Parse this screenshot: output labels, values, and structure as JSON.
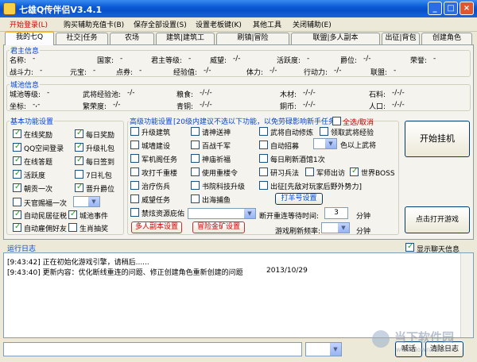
{
  "window": {
    "title": "七雄Q传伴侣V3.4.1",
    "min": "_",
    "max": "□",
    "close": "×"
  },
  "menu": [
    "开始登录(L)",
    "购买辅助充值卡(B)",
    "保存全部设置(S)",
    "设置老板键(K)",
    "其他工具",
    "关闭辅助(E)"
  ],
  "tabs": [
    "我的七Q",
    "社交|任务",
    "农场",
    "建筑|建筑工",
    "刷镇|冒险",
    "联盟|多人副本",
    "出征|背包",
    "创建角色"
  ],
  "lord": {
    "title": "君主信息",
    "row1": [
      {
        "label": "名称:",
        "value": "-"
      },
      {
        "label": "国家:",
        "value": "-"
      },
      {
        "label": "君主等级:",
        "value": "-"
      },
      {
        "label": "威望:",
        "value": "-/-"
      },
      {
        "label": "活跃度:",
        "value": "-"
      },
      {
        "label": "爵位:",
        "value": "-/-"
      },
      {
        "label": "荣誉:",
        "value": "-"
      }
    ],
    "row2": [
      {
        "label": "战斗力:",
        "value": "-"
      },
      {
        "label": "元宝:",
        "value": "-"
      },
      {
        "label": "点券:",
        "value": "-"
      },
      {
        "label": "经验值:",
        "value": "-/-"
      },
      {
        "label": "体力:",
        "value": "-/-"
      },
      {
        "label": "行动力:",
        "value": "-/-"
      },
      {
        "label": "联盟:",
        "value": "-"
      }
    ]
  },
  "city": {
    "title": "城池信息",
    "row1": [
      {
        "label": "城池等级:",
        "value": "-"
      },
      {
        "label": "武将经验池:",
        "value": "-/-"
      },
      {
        "label": "粮食:",
        "value": "-/-/-"
      },
      {
        "label": "木材:",
        "value": "-/-/-"
      },
      {
        "label": "石料:",
        "value": "-/-/-"
      }
    ],
    "row2": [
      {
        "label": "坐标:",
        "value": "-,-"
      },
      {
        "label": "繁荣度:",
        "value": "-/-"
      },
      {
        "label": "青铜:",
        "value": "-/-/-"
      },
      {
        "label": "銅币:",
        "value": "-/-/-"
      },
      {
        "label": "人口:",
        "value": "-/-/-"
      }
    ]
  },
  "basic": {
    "title": "基本功能设置",
    "items": [
      {
        "label": "在线奖励",
        "checked": true
      },
      {
        "label": "每日奖励",
        "checked": true
      },
      {
        "label": "QQ空间登录",
        "checked": true
      },
      {
        "label": "升级礼包",
        "checked": true
      },
      {
        "label": "在线答题",
        "checked": true
      },
      {
        "label": "每日签到",
        "checked": true
      },
      {
        "label": "活跃度",
        "checked": true
      },
      {
        "label": "7日礼包",
        "checked": false
      },
      {
        "label": "朝贡一次",
        "checked": true
      },
      {
        "label": "晋升爵位",
        "checked": true
      }
    ],
    "tianguan": {
      "label": "天官赐福一次",
      "checked": false
    },
    "extra": [
      {
        "label": "自动民居征税",
        "checked": true
      },
      {
        "label": "城池事件",
        "checked": true
      },
      {
        "label": "自动雇佣好友",
        "checked": true
      },
      {
        "label": "生肖抽奖",
        "checked": false
      }
    ]
  },
  "advanced": {
    "title": "高级功能设置",
    "hint": "[20级内建议不选以下功能，以免劳碌影响新手任务]",
    "selectall": {
      "label": "全选/取消",
      "checked": false
    },
    "col1": [
      {
        "label": "升级建筑",
        "checked": false
      },
      {
        "label": "城墙建设",
        "checked": false
      },
      {
        "label": "军机阁任务",
        "checked": false
      },
      {
        "label": "攻打千重楼",
        "checked": false
      },
      {
        "label": "治疗伤兵",
        "checked": false
      },
      {
        "label": "威望任务",
        "checked": false
      },
      {
        "label": "禁炫资源庇佑",
        "checked": false
      }
    ],
    "col2": [
      {
        "label": "请神送神",
        "checked": false
      },
      {
        "label": "百战千军",
        "checked": false
      },
      {
        "label": "神庙祈福",
        "checked": false
      },
      {
        "label": "使用重楼令",
        "checked": false
      },
      {
        "label": "书院科技升级",
        "checked": false
      },
      {
        "label": "出海捕鱼",
        "checked": false
      }
    ],
    "col3": [
      {
        "label": "武将自动修炼",
        "checked": false
      },
      {
        "label": "自动招募",
        "checked": false
      },
      {
        "label": "每日刷新酒馆1次",
        "checked": false
      },
      {
        "label": "研习兵法",
        "checked": false
      }
    ],
    "lingqu": {
      "label": "领取武将经验",
      "checked": false
    },
    "above": "色以上武将",
    "junshi": {
      "label": "军师出访",
      "checked": false
    },
    "boss": {
      "label": "世界BOSS",
      "checked": true
    },
    "chuzheng": {
      "label": "出征[先敌对玩家后野外势力]",
      "checked": false
    },
    "daping_btn": "打羊号设置",
    "fuben_btn": "多人副本设置",
    "maoxian_btn": "冒险金矿设置",
    "reconnect_label": "断开重连等待时间:",
    "reconnect_value": "3",
    "minute1": "分钟",
    "refresh_label": "游戏刷新频率:",
    "minute2": "分钟"
  },
  "actions": {
    "start": "开始挂机",
    "open_game": "点击打开游戏"
  },
  "log": {
    "title": "运行日志",
    "show_chat": {
      "label": "显示聊天信息",
      "checked": true
    },
    "lines": [
      {
        "time": "[9:43:42]",
        "text": "正在初始化游戏引擎，请稍后......",
        "date": ""
      },
      {
        "time": "[9:43:40]",
        "text": "更新内容：优化断线重连的问题、修正创建角色重新创建的问题",
        "date": "2013/10/29"
      }
    ]
  },
  "bottom": {
    "shout": "喊话",
    "clear": "清除日志"
  },
  "watermark": {
    "name": "当下软件园",
    "url": "www.downxia.com"
  }
}
